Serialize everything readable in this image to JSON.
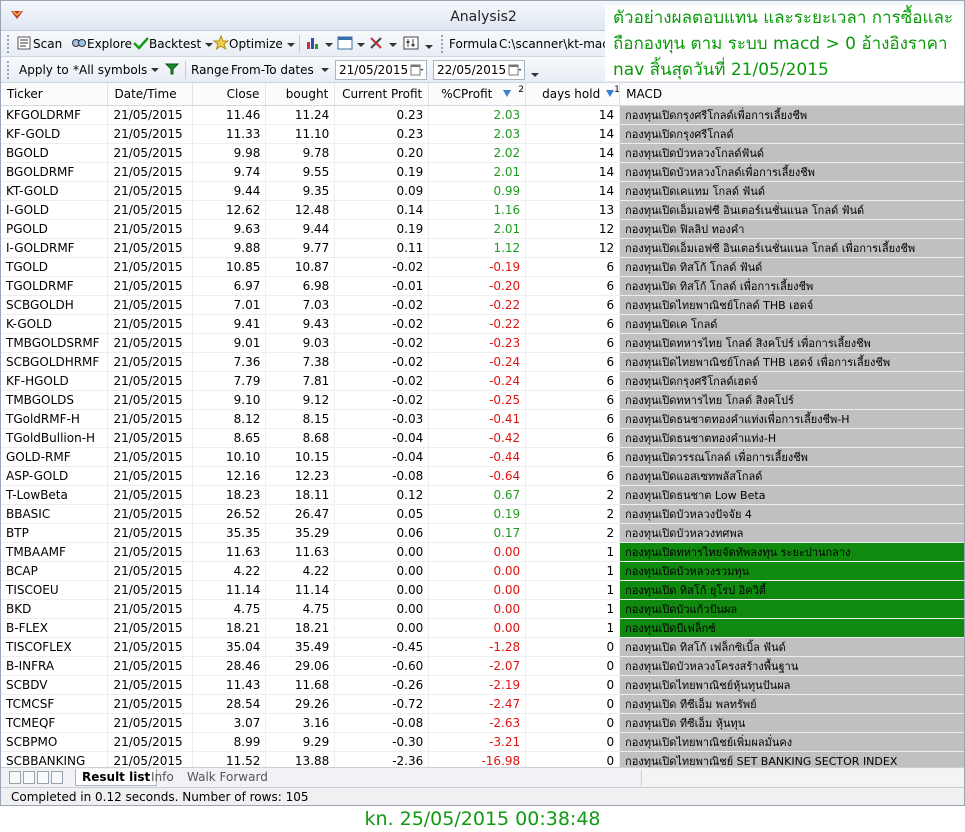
{
  "window": {
    "title": "Analysis2"
  },
  "toolbar1": {
    "scan": "Scan",
    "explore": "Explore",
    "backtest": "Backtest",
    "optimize": "Optimize",
    "formula_label": "Formula",
    "formula_value": "C:\\scanner\\kt-macd-"
  },
  "toolbar2": {
    "apply_to": "Apply to",
    "symbols": "*All symbols",
    "range": "Range",
    "range_value": "From-To dates",
    "from_date": "21/05/2015",
    "to_date": "22/05/2015"
  },
  "annotation": {
    "line1": "ตัวอย่างผลตอบแทน และระยะเวลา การซื้อและ",
    "line2": "ถือกองทุน ตาม ระบบ macd > 0 อ้างอิงราคา",
    "line3": "nav สิ้นสุดวันที่ 21/05/2015"
  },
  "columns": [
    "Ticker",
    "Date/Time",
    "Close",
    "bought",
    "Current Profit",
    "%CProfit",
    "days hold",
    "MACD"
  ],
  "sort_marks": {
    "cprofit": "2",
    "dayshold": "1"
  },
  "rows": [
    [
      "KFGOLDRMF",
      "21/05/2015",
      "11.46",
      "11.24",
      "0.23",
      "2.03",
      "14",
      "กองทุนเปิดกรุงศรีโกลด์เพื่อการเลี้ยงชีพ"
    ],
    [
      "KF-GOLD",
      "21/05/2015",
      "11.33",
      "11.10",
      "0.23",
      "2.03",
      "14",
      "กองทุนเปิดกรุงศรีโกลด์"
    ],
    [
      "BGOLD",
      "21/05/2015",
      "9.98",
      "9.78",
      "0.20",
      "2.02",
      "14",
      "กองทุนเปิดบัวหลวงโกลด์ฟันด์"
    ],
    [
      "BGOLDRMF",
      "21/05/2015",
      "9.74",
      "9.55",
      "0.19",
      "2.01",
      "14",
      "กองทุนเปิดบัวหลวงโกลด์เพื่อการเลี้ยงชีพ"
    ],
    [
      "KT-GOLD",
      "21/05/2015",
      "9.44",
      "9.35",
      "0.09",
      "0.99",
      "14",
      "กองทุนเปิดเคแทม โกลด์ ฟันด์"
    ],
    [
      "I-GOLD",
      "21/05/2015",
      "12.62",
      "12.48",
      "0.14",
      "1.16",
      "13",
      "กองทุนเปิดเอ็มเอฟซี อินเตอร์เนชั่นแนล โกลด์ ฟันด์"
    ],
    [
      "PGOLD",
      "21/05/2015",
      "9.63",
      "9.44",
      "0.19",
      "2.01",
      "12",
      "กองทุนเปิด ฟิลลิป ทองคำ"
    ],
    [
      "I-GOLDRMF",
      "21/05/2015",
      "9.88",
      "9.77",
      "0.11",
      "1.12",
      "12",
      "กองทุนเปิดเอ็มเอฟซี อินเตอร์เนชั่นแนล โกลด์ เพื่อการเลี้ยงชีพ"
    ],
    [
      "TGOLD",
      "21/05/2015",
      "10.85",
      "10.87",
      "-0.02",
      "-0.19",
      "6",
      "กองทุนเปิด ทิสโก้ โกลด์ ฟันด์"
    ],
    [
      "TGOLDRMF",
      "21/05/2015",
      "6.97",
      "6.98",
      "-0.01",
      "-0.20",
      "6",
      "กองทุนเปิด ทิสโก้ โกลด์ เพื่อการเลี้ยงชีพ"
    ],
    [
      "SCBGOLDH",
      "21/05/2015",
      "7.01",
      "7.03",
      "-0.02",
      "-0.22",
      "6",
      "กองทุนเปิดไทยพาณิชย์โกลด์ THB เฮดจ์"
    ],
    [
      "K-GOLD",
      "21/05/2015",
      "9.41",
      "9.43",
      "-0.02",
      "-0.22",
      "6",
      "กองทุนเปิดเค โกลด์"
    ],
    [
      "TMBGOLDSRMF",
      "21/05/2015",
      "9.01",
      "9.03",
      "-0.02",
      "-0.23",
      "6",
      "กองทุนเปิดทหารไทย โกลด์ สิงคโปร์ เพื่อการเลี้ยงชีพ"
    ],
    [
      "SCBGOLDHRMF",
      "21/05/2015",
      "7.36",
      "7.38",
      "-0.02",
      "-0.24",
      "6",
      "กองทุนเปิดไทยพาณิชย์โกลด์ THB เฮดจ์ เพื่อการเลี้ยงชีพ"
    ],
    [
      "KF-HGOLD",
      "21/05/2015",
      "7.79",
      "7.81",
      "-0.02",
      "-0.24",
      "6",
      "กองทุนเปิดกรุงศรีโกลด์เฮดจ์"
    ],
    [
      "TMBGOLDS",
      "21/05/2015",
      "9.10",
      "9.12",
      "-0.02",
      "-0.25",
      "6",
      "กองทุนเปิดทหารไทย โกลด์ สิงคโปร์"
    ],
    [
      "TGoldRMF-H",
      "21/05/2015",
      "8.12",
      "8.15",
      "-0.03",
      "-0.41",
      "6",
      "กองทุนเปิดธนชาตทองคำแท่งเพื่อการเลี้ยงชีพ-H"
    ],
    [
      "TGoldBullion-H",
      "21/05/2015",
      "8.65",
      "8.68",
      "-0.04",
      "-0.42",
      "6",
      "กองทุนเปิดธนชาตทองคำแท่ง-H"
    ],
    [
      "GOLD-RMF",
      "21/05/2015",
      "10.10",
      "10.15",
      "-0.04",
      "-0.44",
      "6",
      "กองทุนเปิดวรรณโกลด์ เพื่อการเลี้ยงชีพ"
    ],
    [
      "ASP-GOLD",
      "21/05/2015",
      "12.16",
      "12.23",
      "-0.08",
      "-0.64",
      "6",
      "กองทุนเปิดแอสเซทพลัสโกลด์"
    ],
    [
      "T-LowBeta",
      "21/05/2015",
      "18.23",
      "18.11",
      "0.12",
      "0.67",
      "2",
      "กองทุนเปิดธนชาต Low Beta"
    ],
    [
      "BBASIC",
      "21/05/2015",
      "26.52",
      "26.47",
      "0.05",
      "0.19",
      "2",
      "กองทุนเปิดบัวหลวงปัจจัย 4"
    ],
    [
      "BTP",
      "21/05/2015",
      "35.35",
      "35.29",
      "0.06",
      "0.17",
      "2",
      "กองทุนเปิดบัวหลวงทศพล"
    ],
    [
      "TMBAAMF",
      "21/05/2015",
      "11.63",
      "11.63",
      "0.00",
      "0.00",
      "1",
      "กองทุนเปิดทหารไทยจัดทัพลงทุน ระยะปานกลาง"
    ],
    [
      "BCAP",
      "21/05/2015",
      "4.22",
      "4.22",
      "0.00",
      "0.00",
      "1",
      "กองทุนเปิดบัวหลวงรวมทุน"
    ],
    [
      "TISCOEU",
      "21/05/2015",
      "11.14",
      "11.14",
      "0.00",
      "0.00",
      "1",
      "กองทุนเปิด ทิสโก้ ยุโรป อิควิตี้"
    ],
    [
      "BKD",
      "21/05/2015",
      "4.75",
      "4.75",
      "0.00",
      "0.00",
      "1",
      "กองทุนเปิดบัวแก้วปันผล"
    ],
    [
      "B-FLEX",
      "21/05/2015",
      "18.21",
      "18.21",
      "0.00",
      "0.00",
      "1",
      "กองทุนเปิดบีเฟล็กซ์"
    ],
    [
      "TISCOFLEX",
      "21/05/2015",
      "35.04",
      "35.49",
      "-0.45",
      "-1.28",
      "0",
      "กองทุนเปิด ทิสโก้ เฟล็กซิเบิ้ล ฟันด์"
    ],
    [
      "B-INFRA",
      "21/05/2015",
      "28.46",
      "29.06",
      "-0.60",
      "-2.07",
      "0",
      "กองทุนเปิดบัวหลวงโครงสร้างพื้นฐาน"
    ],
    [
      "SCBDV",
      "21/05/2015",
      "11.43",
      "11.68",
      "-0.26",
      "-2.19",
      "0",
      "กองทุนเปิดไทยพาณิชย์หุ้นทุนปันผล"
    ],
    [
      "TCMCSF",
      "21/05/2015",
      "28.54",
      "29.26",
      "-0.72",
      "-2.47",
      "0",
      "กองทุนเปิด ทีซีเอ็ม พลทรัพย์"
    ],
    [
      "TCMEQF",
      "21/05/2015",
      "3.07",
      "3.16",
      "-0.08",
      "-2.63",
      "0",
      "กองทุนเปิด ทีซีเอ็ม หุ้นทุน"
    ],
    [
      "SCBPMO",
      "21/05/2015",
      "8.99",
      "9.29",
      "-0.30",
      "-3.21",
      "0",
      "กองทุนเปิดไทยพาณิชย์เพิ่มผลมั่นคง"
    ],
    [
      "SCBBANKING",
      "21/05/2015",
      "11.52",
      "13.88",
      "-2.36",
      "-16.98",
      "0",
      "กองทุนเปิดไทยพาณิชย์ SET BANKING SECTOR INDEX"
    ]
  ],
  "green_macd_rows": [
    23,
    24,
    25,
    26,
    27
  ],
  "tabs": [
    "Result list",
    "Info",
    "Walk Forward"
  ],
  "status": "Completed in 0.12 seconds. Number of rows: 105",
  "caption": "kn. 25/05/2015 00:38:48",
  "colors": {
    "positive": "#1f9a1f",
    "negative": "#e01414",
    "macd_gray": "#c0c0c0",
    "macd_green": "#0f8a0f",
    "annotation": "#0a9a0a"
  }
}
